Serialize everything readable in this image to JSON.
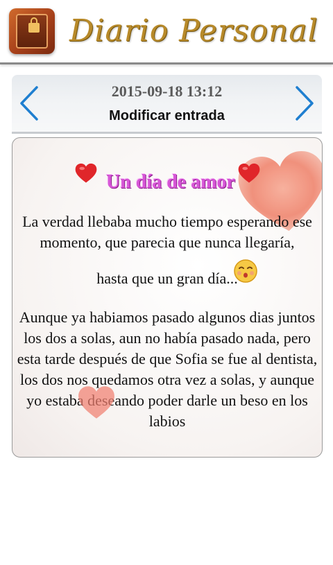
{
  "header": {
    "app_title": "Diario Personal",
    "app_icon": "diary-book-lock-icon"
  },
  "entry_nav": {
    "date": "2015-09-18 13:12",
    "subtitle": "Modificar entrada",
    "prev_icon": "chevron-left-icon",
    "next_icon": "chevron-right-icon",
    "accent_color": "#1f7fd0"
  },
  "entry": {
    "title": "Un día de amor",
    "title_color": "#d655d6",
    "paragraph_1": "La verdad llebaba mucho tiempo esperando ese momento, que parecia que nunca llegaría,",
    "paragraph_2": "hasta que un gran día...",
    "paragraph_3": "Aunque ya habiamos pasado algunos dias juntos los dos a solas, aun no había pasado nada, pero esta tarde después de que Sofia se fue al dentista, los dos nos quedamos otra vez a solas, y aunque yo estaba deseando poder darle un beso en los labios",
    "decorations": [
      "heart-icon",
      "kiss-emoji-icon"
    ]
  }
}
